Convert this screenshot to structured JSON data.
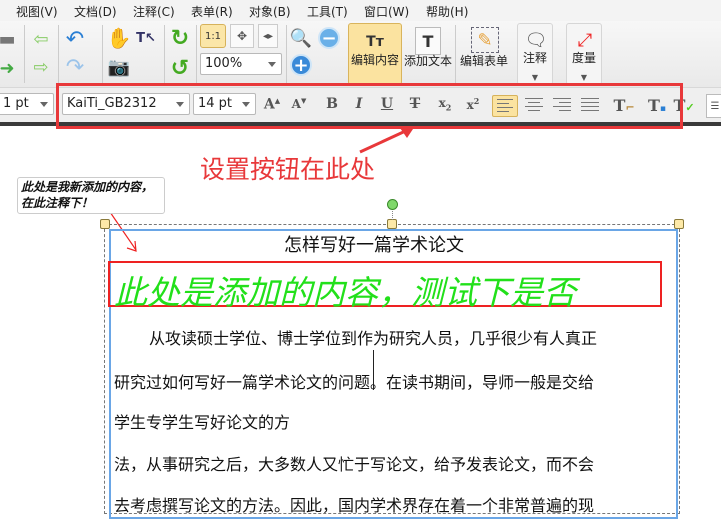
{
  "menu": [
    "视图(V)",
    "文档(D)",
    "注释(C)",
    "表单(R)",
    "对象(B)",
    "工具(T)",
    "窗口(W)",
    "帮助(H)"
  ],
  "toolbar": {
    "zoom": "100%",
    "edit_content": "编辑内容",
    "add_text": "添加文本",
    "edit_form": "编辑表单",
    "annotate": "注释",
    "measure": "度量"
  },
  "format": {
    "line_width": "1 pt",
    "font": "KaiTi_GB2312",
    "size": "14 pt"
  },
  "callout": "设置按钮在此处",
  "note": "此处是我新添加的内容，在此注释下！",
  "doc": {
    "title": "怎样写好一篇学术论文",
    "added": "此处是添加的内容，测试下是否",
    "lines": [
      "从攻读硕士学位、博士学位到作为研究人员，几乎很少有人真正",
      "研究过如何写好一篇学术论文的问题。在读书期间，导师一般是交给",
      "学生专学生写好论文的方",
      "法，从事研究之后，大多数人又忙于写论文，给予发表论文，而不会",
      "去考虑撰写论文的方法。因此，国内学术界存在着一个非常普遍的现"
    ]
  },
  "colors": {
    "accent_red": "#e8383a",
    "added_text": "#22e01a",
    "selection": "#4a90e2"
  }
}
